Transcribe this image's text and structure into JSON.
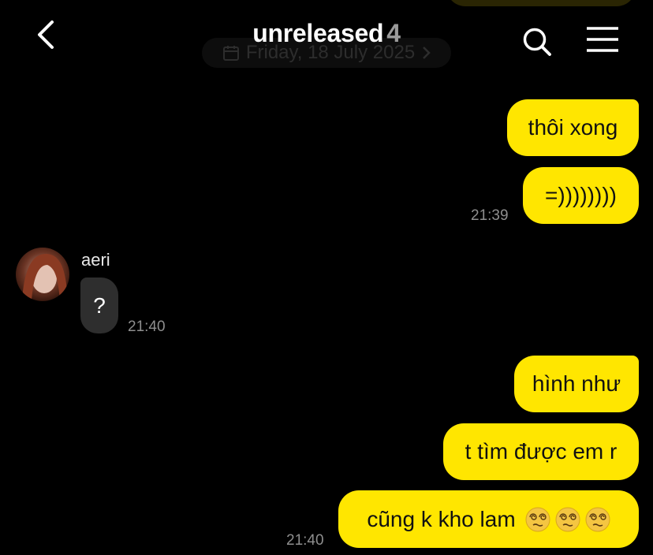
{
  "header": {
    "title": "unreleased",
    "member_count": "4",
    "date_label": "Friday, 18 July 2025"
  },
  "colors": {
    "outgoing_bubble": "#ffe600",
    "incoming_bubble": "#2e2e2e",
    "background": "#000000",
    "timestamp": "#8e8e8e"
  },
  "icons": {
    "back": "chevron-left-icon",
    "search": "search-icon",
    "menu": "hamburger-menu-icon",
    "calendar": "calendar-icon",
    "date_chevron": "chevron-right-icon",
    "emoji": "dizzy-face-emoji"
  },
  "messages": [
    {
      "direction": "out",
      "text": "thôi xong"
    },
    {
      "direction": "out",
      "text": "=))))))))",
      "time": "21:39"
    },
    {
      "direction": "in",
      "sender": "aeri",
      "text": "?",
      "time": "21:40"
    },
    {
      "direction": "out",
      "text": "hình như"
    },
    {
      "direction": "out",
      "text": "t tìm được em r"
    },
    {
      "direction": "out",
      "text": "cũng k kho lam",
      "emoji": "😵‍💫😵‍💫😵‍💫",
      "time": "21:40"
    }
  ]
}
